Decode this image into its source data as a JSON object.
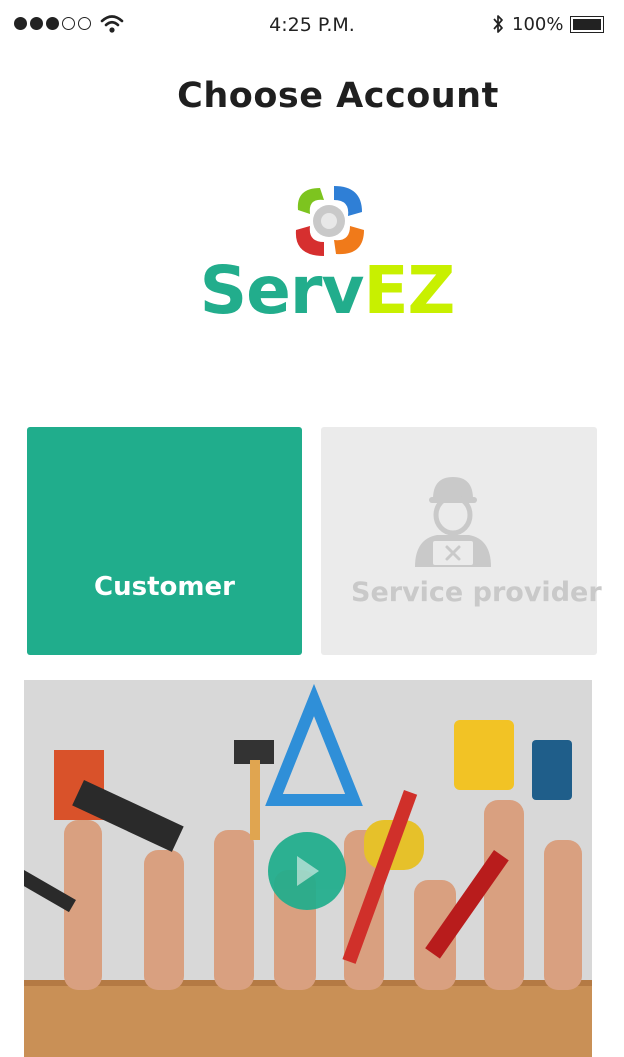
{
  "status_bar": {
    "time": "4:25 P.M.",
    "battery_percent": "100%",
    "signal_strength": 3,
    "signal_max": 5,
    "battery_level": 1.0
  },
  "header": {
    "title": "Choose Account"
  },
  "logo": {
    "word_part1": "Serv",
    "word_part2": "EZ"
  },
  "accounts": {
    "customer_label": "Customer",
    "provider_label": "Service provider",
    "selected": "customer"
  },
  "colors": {
    "accent": "#20ad8c",
    "logo_ez": "#c8f000",
    "provider_card_bg": "#ebebeb",
    "provider_text": "#c9c9c9"
  },
  "icons": {
    "provider_icon": "service-provider-avatar-icon",
    "play_icon": "play-icon",
    "wifi_icon": "wifi-icon",
    "bluetooth_icon": "bluetooth-icon",
    "battery_icon": "battery-icon"
  }
}
